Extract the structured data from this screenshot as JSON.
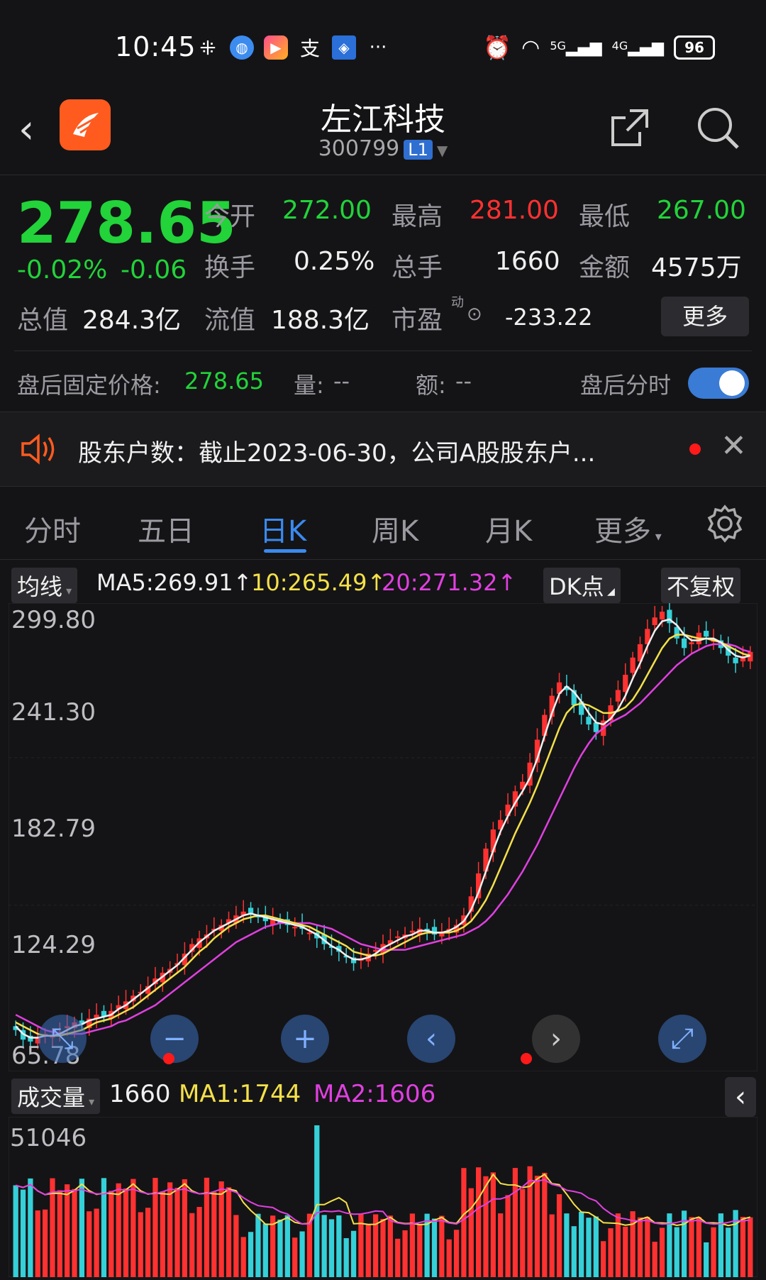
{
  "status": {
    "time": "10:45",
    "battery": "96",
    "net1": "5G",
    "net2": "4G"
  },
  "header": {
    "title": "左江科技",
    "code": "300799",
    "level": "L1"
  },
  "quote": {
    "price": "278.65",
    "pct": "-0.02%",
    "chg": "-0.06",
    "open_label": "今开",
    "open": "272.00",
    "high_label": "最高",
    "high": "281.00",
    "low_label": "最低",
    "low": "267.00",
    "turnover_label": "换手",
    "turnover": "0.25%",
    "vol_label": "总手",
    "vol": "1660",
    "amount_label": "金额",
    "amount": "4575万",
    "mktcap_label": "总值",
    "mktcap": "284.3亿",
    "float_label": "流值",
    "float": "188.3亿",
    "pe_label": "市盈",
    "pe_sup": "动",
    "pe": "-233.22",
    "more": "更多"
  },
  "after_hours": {
    "label": "盘后固定价格:",
    "price": "278.65",
    "vol_label": "量:",
    "vol": "--",
    "amt_label": "额:",
    "amt": "--",
    "toggle_label": "盘后分时"
  },
  "notice": {
    "text": "股东户数：截止2023-06-30，公司A股股东户..."
  },
  "tabs": [
    "分时",
    "五日",
    "日K",
    "周K",
    "月K",
    "更多"
  ],
  "ma": {
    "selector": "均线",
    "ma5": "MA5:269.91↑",
    "ma10": "10:265.49↑",
    "ma20": "20:271.32↑",
    "dk": "DK点",
    "adjust": "不复权"
  },
  "yaxis": [
    "299.80",
    "241.30",
    "182.79",
    "124.29",
    "65.78"
  ],
  "volume": {
    "selector": "成交量",
    "value": "1660",
    "ma1": "MA1:1744",
    "ma2": "MA2:1606",
    "max": "51046"
  },
  "colors": {
    "up": "#ff3131",
    "down": "#22d33a",
    "accent": "#3a8af0",
    "brand": "#ff5b1f"
  },
  "chart_data": {
    "type": "candlestick",
    "ylim": [
      65.78,
      299.8
    ],
    "close": [
      80,
      75,
      74,
      76,
      78,
      77,
      79,
      82,
      84,
      83,
      86,
      88,
      87,
      90,
      93,
      95,
      98,
      100,
      103,
      107,
      110,
      112,
      115,
      120,
      125,
      128,
      130,
      133,
      135,
      138,
      140,
      142,
      141,
      139,
      137,
      138,
      136,
      135,
      134,
      133,
      131,
      128,
      125,
      123,
      121,
      118,
      115,
      117,
      120,
      122,
      125,
      127,
      129,
      130,
      132,
      133,
      132,
      130,
      131,
      133,
      135,
      140,
      150,
      162,
      175,
      185,
      190,
      198,
      205,
      210,
      220,
      232,
      245,
      255,
      262,
      258,
      250,
      245,
      240,
      236,
      242,
      250,
      258,
      266,
      275,
      282,
      290,
      296,
      299,
      293,
      285,
      280,
      283,
      288,
      286,
      284,
      280,
      276,
      272,
      275,
      278
    ],
    "ma5": [
      82,
      78,
      76,
      76,
      77,
      77,
      78,
      80,
      82,
      83,
      85,
      86,
      87,
      88,
      91,
      93,
      96,
      99,
      102,
      105,
      108,
      111,
      114,
      118,
      122,
      126,
      129,
      132,
      134,
      136,
      138,
      140,
      141,
      140,
      139,
      138,
      137,
      136,
      135,
      134,
      132,
      130,
      127,
      124,
      122,
      119,
      117,
      117,
      118,
      120,
      123,
      125,
      127,
      129,
      130,
      132,
      132,
      131,
      131,
      132,
      134,
      137,
      143,
      152,
      163,
      174,
      184,
      192,
      199,
      205,
      212,
      222,
      234,
      246,
      256,
      260,
      257,
      252,
      246,
      241,
      240,
      243,
      248,
      255,
      264,
      272,
      281,
      289,
      294,
      295,
      292,
      287,
      284,
      284,
      285,
      285,
      283,
      279,
      276,
      275,
      276
    ],
    "ma10": [
      84,
      82,
      80,
      78,
      77,
      77,
      77,
      78,
      79,
      80,
      82,
      84,
      85,
      86,
      88,
      90,
      92,
      95,
      98,
      101,
      104,
      107,
      110,
      113,
      117,
      121,
      124,
      128,
      131,
      134,
      136,
      138,
      139,
      140,
      140,
      139,
      138,
      137,
      136,
      135,
      134,
      132,
      130,
      128,
      126,
      124,
      121,
      120,
      119,
      119,
      120,
      122,
      124,
      126,
      128,
      130,
      131,
      131,
      131,
      131,
      132,
      134,
      137,
      142,
      148,
      156,
      165,
      174,
      183,
      191,
      199,
      208,
      218,
      228,
      238,
      246,
      250,
      251,
      250,
      248,
      246,
      246,
      247,
      249,
      253,
      259,
      266,
      273,
      280,
      285,
      287,
      287,
      286,
      285,
      285,
      284,
      283,
      281,
      279,
      277,
      276
    ],
    "ma20": [
      88,
      86,
      84,
      82,
      80,
      79,
      78,
      78,
      78,
      78,
      79,
      80,
      81,
      82,
      84,
      85,
      87,
      89,
      91,
      93,
      96,
      99,
      102,
      105,
      108,
      111,
      114,
      117,
      120,
      123,
      126,
      128,
      130,
      132,
      134,
      135,
      136,
      136,
      136,
      136,
      136,
      135,
      134,
      133,
      131,
      129,
      127,
      125,
      124,
      123,
      122,
      122,
      122,
      122,
      123,
      124,
      125,
      126,
      127,
      128,
      129,
      130,
      132,
      134,
      137,
      141,
      146,
      151,
      157,
      163,
      170,
      177,
      185,
      193,
      201,
      209,
      217,
      224,
      230,
      235,
      238,
      241,
      243,
      245,
      248,
      251,
      255,
      259,
      263,
      267,
      271,
      274,
      277,
      279,
      281,
      282,
      282,
      282,
      281,
      279,
      278
    ]
  }
}
